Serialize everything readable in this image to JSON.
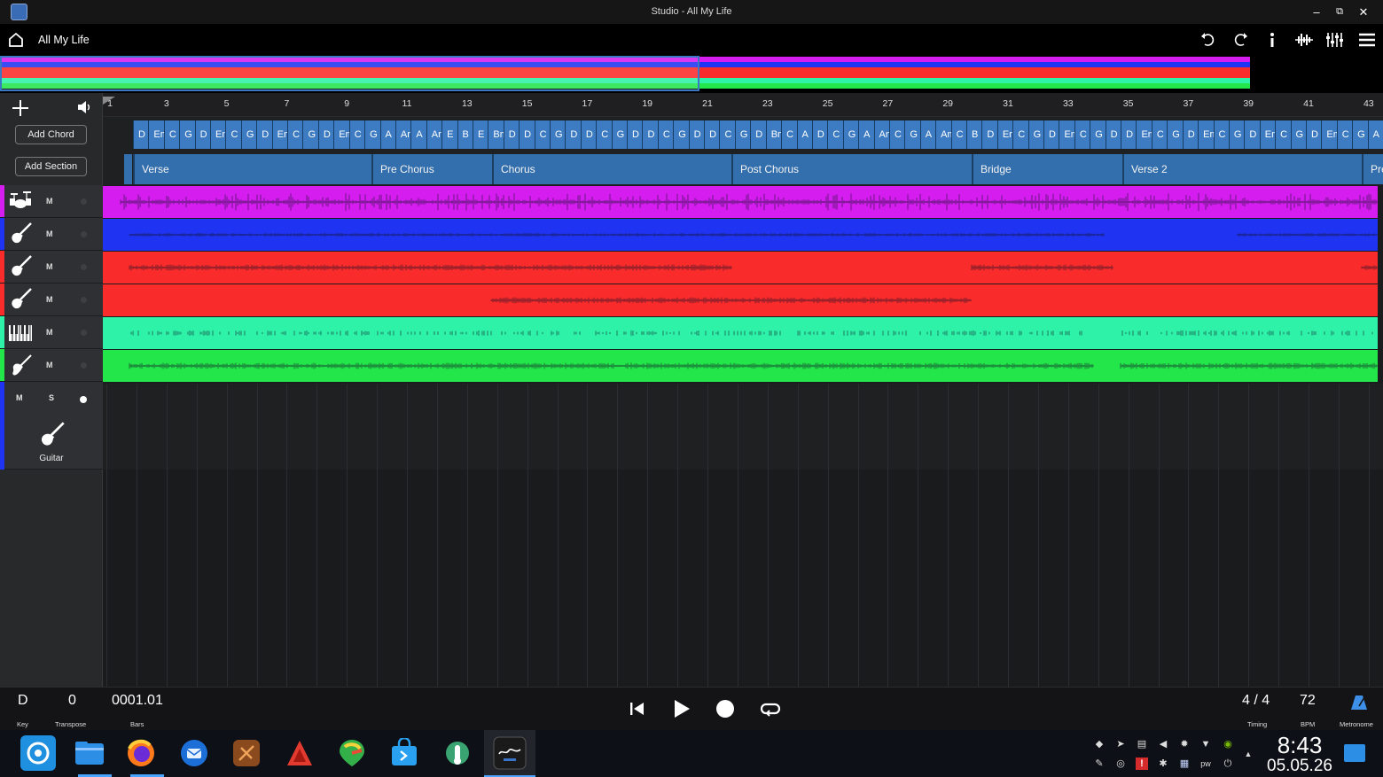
{
  "window": {
    "title": "Studio - All My Life",
    "controls": {
      "minimize": "–",
      "maximize": "⧉",
      "close": "✕"
    }
  },
  "header": {
    "song_title": "All My Life",
    "icons": [
      "home-icon",
      "undo-icon",
      "redo-icon",
      "info-icon",
      "waveform-icon",
      "mixer-icon",
      "menu-icon"
    ]
  },
  "ruler": {
    "bars": [
      "1",
      "3",
      "5",
      "7",
      "9",
      "11",
      "13",
      "15",
      "17",
      "19",
      "21",
      "23",
      "25",
      "27",
      "29",
      "31",
      "33",
      "35",
      "37",
      "39",
      "41",
      "43"
    ]
  },
  "left_panel": {
    "add_chord": "Add Chord",
    "add_section": "Add Section"
  },
  "chords": [
    "D",
    "Em",
    "C",
    "G",
    "D",
    "Em",
    "C",
    "G",
    "D",
    "Em",
    "C",
    "G",
    "D",
    "Em",
    "C",
    "G",
    "A",
    "Am",
    "A",
    "Am",
    "E",
    "B",
    "E",
    "Bm",
    "D",
    "D",
    "C",
    "G",
    "D",
    "D",
    "C",
    "G",
    "D",
    "D",
    "C",
    "G",
    "D",
    "D",
    "C",
    "G",
    "D",
    "Bm",
    "C",
    "A",
    "D",
    "C",
    "G",
    "A",
    "Am",
    "C",
    "G",
    "A",
    "Am",
    "C",
    "B",
    "D",
    "Em",
    "C",
    "G",
    "D",
    "Em",
    "C",
    "G",
    "D",
    "D",
    "Em",
    "C",
    "G",
    "D",
    "Em",
    "C",
    "G",
    "D",
    "Em",
    "C",
    "G",
    "D",
    "Em",
    "C",
    "G",
    "A"
  ],
  "sections": [
    "Verse",
    "Pre Chorus",
    "Chorus",
    "Post Chorus",
    "Bridge",
    "Verse 2",
    "Pre"
  ],
  "tracks": [
    {
      "name": "drums",
      "color": "#d51df0",
      "icon": "drums-icon",
      "mute": "M"
    },
    {
      "name": "guitar-1",
      "color": "#1f34f2",
      "icon": "electric-guitar-icon",
      "mute": "M"
    },
    {
      "name": "guitar-2",
      "color": "#fa2b2b",
      "icon": "electric-guitar-icon",
      "mute": "M"
    },
    {
      "name": "guitar-3",
      "color": "#fa2b2b",
      "icon": "electric-guitar-icon",
      "mute": "M"
    },
    {
      "name": "keys",
      "color": "#2ef2a8",
      "icon": "keyboard-icon",
      "mute": "M"
    },
    {
      "name": "bass",
      "color": "#22e64a",
      "icon": "bass-guitar-icon",
      "mute": "M"
    }
  ],
  "new_track": {
    "mute": "M",
    "solo": "S",
    "label": "Guitar"
  },
  "transport": {
    "key": "D",
    "key_label": "Key",
    "transpose": "0",
    "transpose_label": "Transpose",
    "position": "0001.01",
    "position_label": "Bars",
    "timing": "4 / 4",
    "timing_label": "Timing",
    "bpm": "72",
    "bpm_label": "BPM",
    "metronome_label": "Metronome"
  },
  "taskbar": {
    "apps": [
      "settings-app-icon",
      "files-app-icon",
      "firefox-icon",
      "thunderbird-icon",
      "app-icon",
      "git-icon",
      "maps-app-icon",
      "store-icon",
      "app-settings-icon",
      "fender-studio-icon"
    ],
    "clock": {
      "time": "8:43",
      "date": "05.05.26"
    }
  }
}
